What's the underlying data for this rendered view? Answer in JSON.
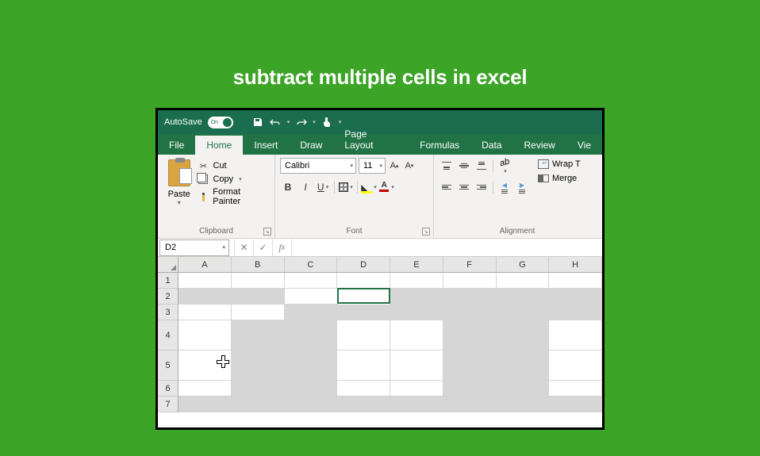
{
  "page_title": "subtract multiple cells in excel",
  "title_bar": {
    "autosave_label": "AutoSave",
    "toggle_state": "On"
  },
  "tabs": {
    "file": "File",
    "home": "Home",
    "insert": "Insert",
    "draw": "Draw",
    "page_layout": "Page Layout",
    "formulas": "Formulas",
    "data": "Data",
    "review": "Review",
    "view": "Vie"
  },
  "ribbon": {
    "clipboard": {
      "paste": "Paste",
      "cut": "Cut",
      "copy": "Copy",
      "format_painter": "Format Painter",
      "group_label": "Clipboard"
    },
    "font": {
      "font_name": "Calibri",
      "font_size": "11",
      "group_label": "Font"
    },
    "alignment": {
      "wrap_text": "Wrap T",
      "merge": "Merge",
      "group_label": "Alignment"
    }
  },
  "name_box": "D2",
  "columns": [
    "A",
    "B",
    "C",
    "D",
    "E",
    "F",
    "G",
    "H"
  ],
  "rows": [
    "1",
    "2",
    "3",
    "4",
    "5",
    "6",
    "7"
  ]
}
